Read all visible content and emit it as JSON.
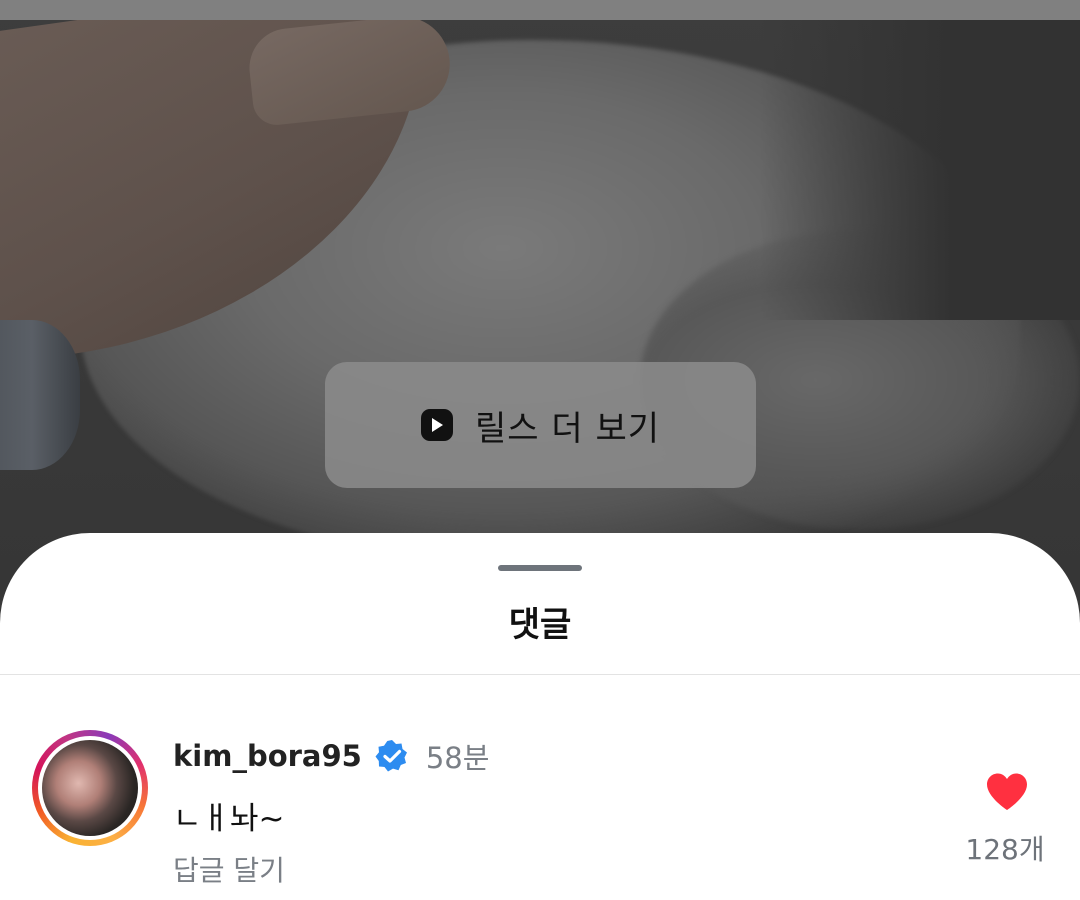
{
  "media": {
    "reels_button_label": "릴스 더 보기",
    "reels_icon": "play-icon"
  },
  "comments_sheet": {
    "title": "댓글"
  },
  "comment": {
    "username": "kim_bora95",
    "verified_icon": "verified-badge-icon",
    "time": "58분",
    "text": "ㄴㅐ놔~",
    "reply_label": "답글 달기",
    "like_icon": "heart-icon",
    "like_count": "128개"
  },
  "colors": {
    "accent_verified": "#2d8cf0",
    "like_red": "#ff3040",
    "sheet_background": "#ffffff"
  }
}
